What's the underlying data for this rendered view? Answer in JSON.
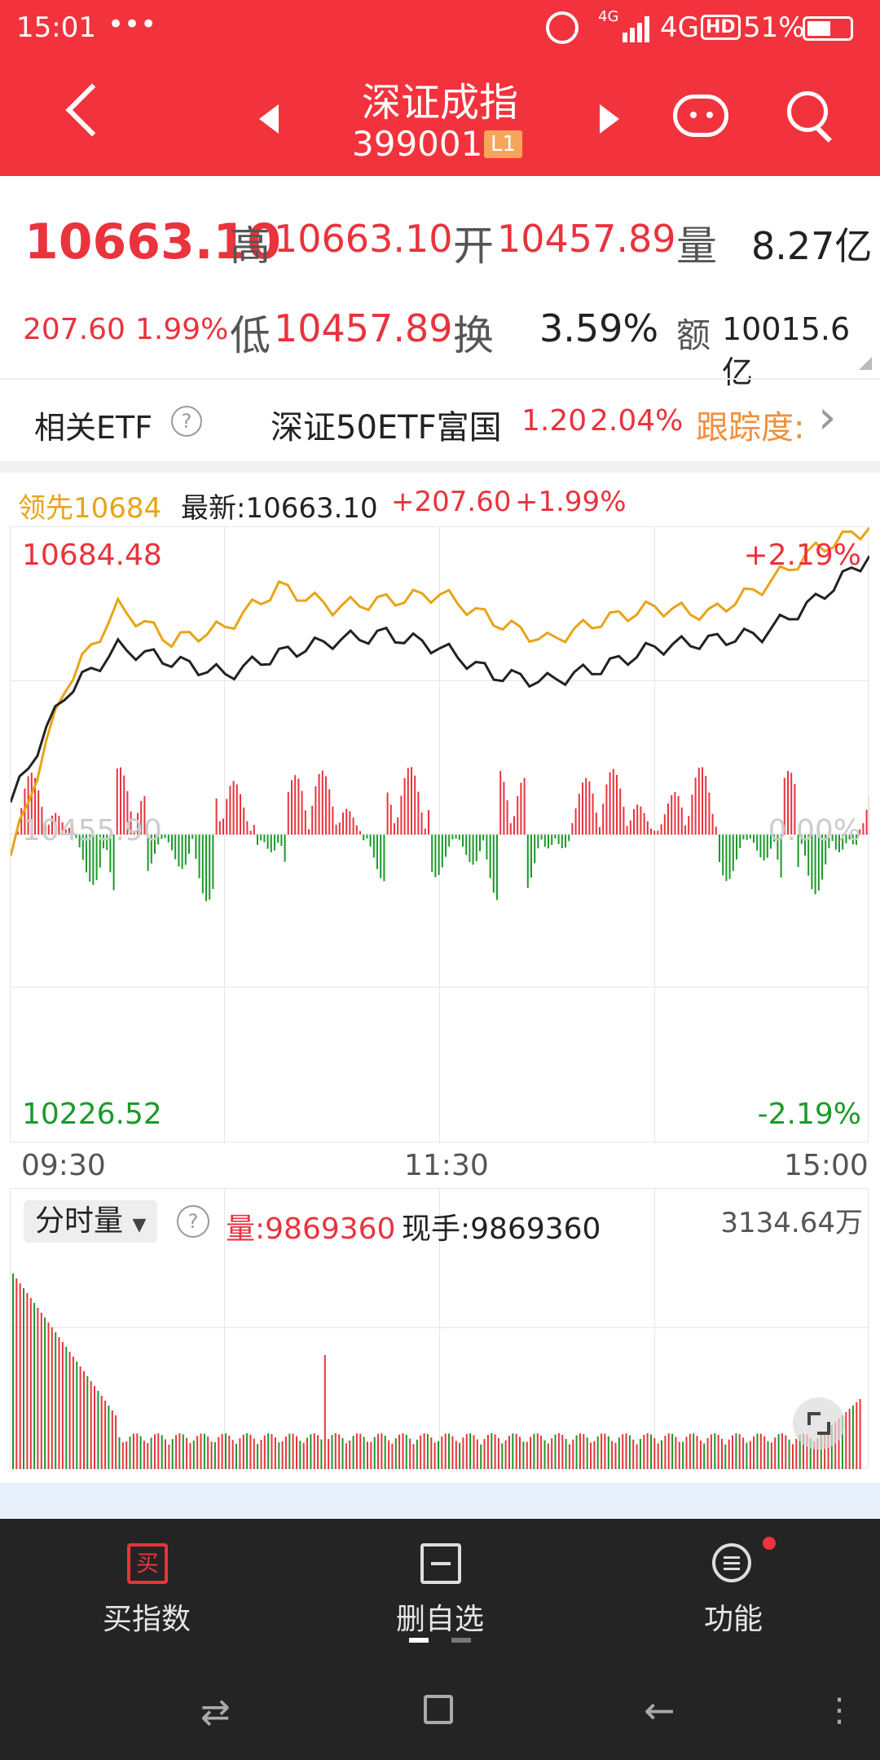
{
  "status": {
    "time": "15:01",
    "dots": "•••",
    "net1": "4G",
    "net2": "4G",
    "hd": "HD",
    "battery": "51%"
  },
  "nav": {
    "title": "深证成指",
    "code": "399001",
    "level_badge": "L1"
  },
  "quote": {
    "price": "10663.10",
    "change": "207.60",
    "change_pct": "1.99%",
    "high_label": "高",
    "high": "10663.10",
    "open_label": "开",
    "open": "10457.89",
    "volume_label": "量",
    "volume": "8.27亿",
    "low_label": "低",
    "low": "10457.89",
    "turnover_label": "换",
    "turnover": "3.59%",
    "amount_label": "额",
    "amount": "10015.6亿"
  },
  "etf": {
    "label": "相关ETF",
    "help": "?",
    "name": "深证50ETF富国",
    "price": "1.20",
    "pct": "2.04%",
    "tracking": "跟踪度:",
    "arrow": "›"
  },
  "chart_header": {
    "lead": "领先10684",
    "latest": "最新:10663.10",
    "chg": "+207.60",
    "pct": "+1.99%"
  },
  "chart_labels": {
    "top_value": "10684.48",
    "top_pct": "+2.19%",
    "mid_value": "10455.90",
    "mid_pct": "0.00%",
    "bottom_value": "10226.52",
    "bottom_pct": "-2.19%",
    "time_start": "09:30",
    "time_mid": "11:30",
    "time_end": "15:00"
  },
  "volume_panel": {
    "selector": "分时量",
    "help": "?",
    "vol": "量:9869360",
    "hand": "现手:9869360",
    "max": "3134.64万"
  },
  "bottom_nav": {
    "buy_icon_text": "买",
    "buy": "买指数",
    "remove": "删自选",
    "func": "功能"
  },
  "colors": {
    "accent": "#f2333d",
    "up": "#e9333d",
    "down": "#1a9a28",
    "lead_line": "#e8a417",
    "price_line": "#222222"
  },
  "chart_data": {
    "type": "line",
    "x": [
      "09:30",
      "11:30",
      "15:00"
    ],
    "ylim": [
      10226.52,
      10684.48
    ],
    "base": 10455.9,
    "series": [
      {
        "name": "领先",
        "values": [
          10440,
          10565,
          10625,
          10600,
          10610,
          10640,
          10625,
          10630,
          10635,
          10615,
          10600,
          10615,
          10625,
          10620,
          10640,
          10668,
          10684
        ]
      },
      {
        "name": "最新",
        "values": [
          10480,
          10560,
          10595,
          10585,
          10575,
          10590,
          10600,
          10605,
          10595,
          10575,
          10570,
          10580,
          10595,
          10600,
          10605,
          10630,
          10663
        ]
      }
    ]
  }
}
